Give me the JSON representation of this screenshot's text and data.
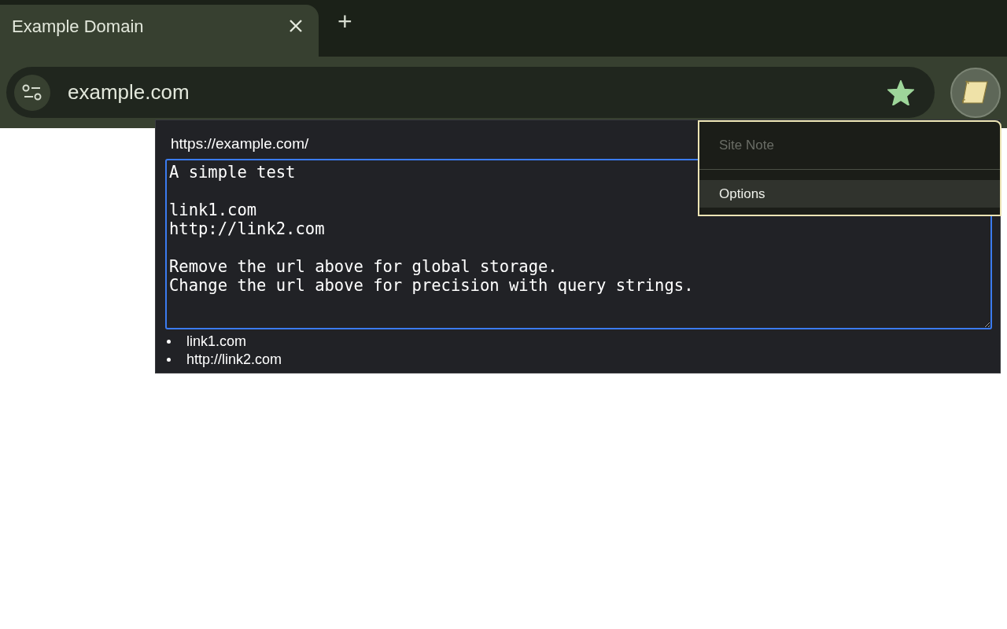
{
  "tabs": [
    {
      "title": "Example Domain",
      "selected": true
    }
  ],
  "new_tab": "+",
  "address_bar": {
    "url": "example.com",
    "bookmarked": true
  },
  "note_popup": {
    "page_url": "https://example.com/",
    "note": "A simple test\n\nlink1.com\nhttp://link2.com\n\nRemove the url above for global storage.\nChange the url above for precision with query strings.",
    "links": [
      "link1.com",
      "http://link2.com"
    ]
  },
  "context_menu": {
    "items": [
      {
        "label": "Site Note",
        "disabled": true,
        "selected": false
      },
      {
        "label": "Options",
        "disabled": false,
        "selected": true
      }
    ]
  }
}
